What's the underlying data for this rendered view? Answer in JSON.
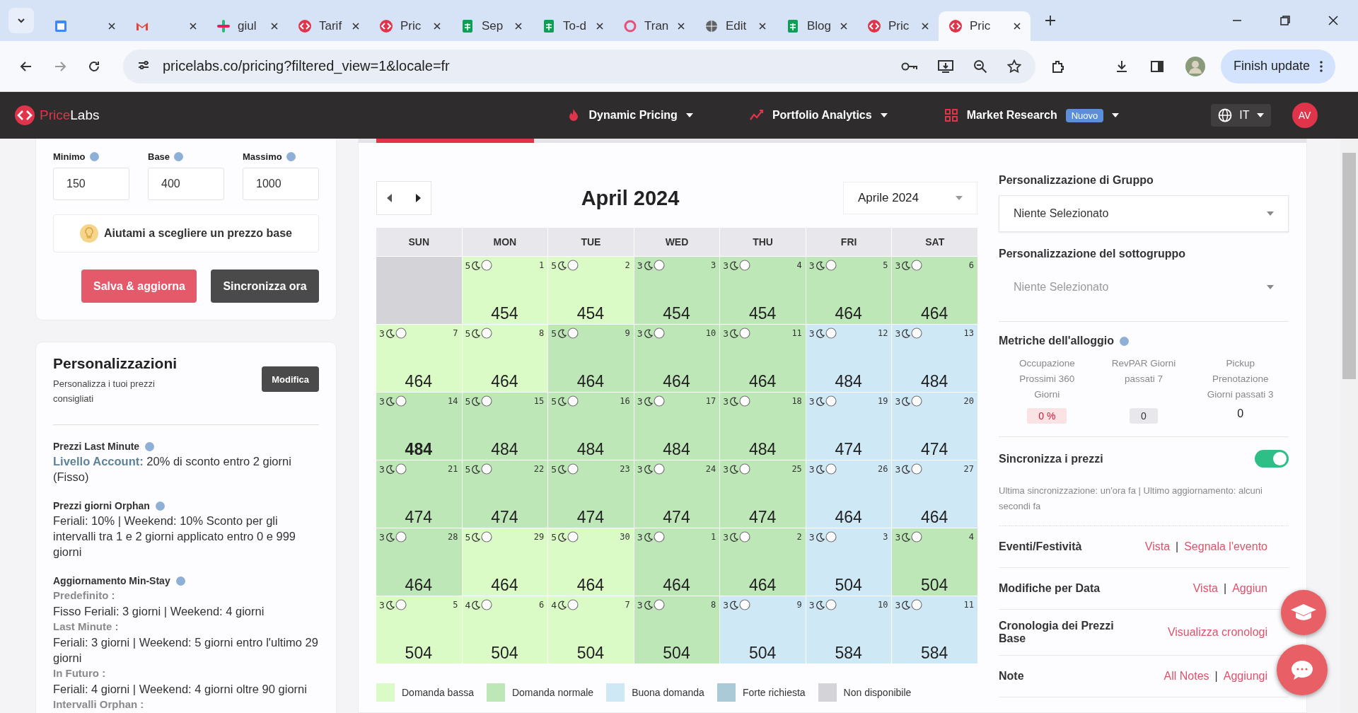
{
  "browser": {
    "tabs": [
      {
        "selected": false
      },
      {
        "selected": false
      },
      {
        "title": "giul",
        "selected": false
      },
      {
        "title": "Tarif",
        "selected": false
      },
      {
        "title": "Pric",
        "selected": false
      },
      {
        "title": "Sep",
        "selected": false
      },
      {
        "title": "To-d",
        "selected": false
      },
      {
        "title": "Tran",
        "selected": false
      },
      {
        "title": "Edit",
        "selected": false
      },
      {
        "title": "Blog",
        "selected": false
      },
      {
        "title": "Pric",
        "selected": false
      },
      {
        "title": "Pric",
        "selected": true
      }
    ],
    "url": "pricelabs.co/pricing?filtered_view=1&locale=fr",
    "update": "Finish update"
  },
  "header": {
    "logo_a": "Price",
    "logo_b": "Labs",
    "nav": [
      {
        "label": "Dynamic Pricing"
      },
      {
        "label": "Portfolio Analytics"
      },
      {
        "label": "Market Research",
        "badge": "Nuovo"
      }
    ],
    "language": "IT",
    "avatar": "AV"
  },
  "prices": {
    "fields": [
      {
        "label": "Minimo",
        "value": "150"
      },
      {
        "label": "Base",
        "value": "400"
      },
      {
        "label": "Massimo",
        "value": "1000"
      }
    ],
    "help": "Aiutami a scegliere un prezzo base",
    "save": "Salva & aggiorna",
    "sync": "Sincronizza ora"
  },
  "customizations": {
    "title": "Personalizzazioni",
    "subtitle": "Personalizza i tuoi prezzi consigliati",
    "edit": "Modifica",
    "sections": [
      {
        "title": "Prezzi Last Minute",
        "lines": [
          {
            "kind": "text",
            "text": "**Livello Account:** 20% di sconto entro 2 giorni (Fisso)"
          }
        ]
      },
      {
        "title": "Prezzi giorni Orphan",
        "lines": [
          {
            "kind": "text",
            "text": "Feriali: 10% | Weekend: 10% Sconto per gli intervalli tra 1 e 2 giorni applicato entro 0 e 999 giorni"
          }
        ]
      },
      {
        "title": "Aggiornamento Min-Stay",
        "lines": [
          {
            "kind": "heading",
            "text": "Predefinito :"
          },
          {
            "kind": "text",
            "text": "Fisso Feriali: 3 giorni | Weekend: 4 giorni"
          },
          {
            "kind": "heading",
            "text": "Last Minute :"
          },
          {
            "kind": "text",
            "text": "Feriali: 3 giorni | Weekend: 5 giorni entro l'ultimo 29 giorni"
          },
          {
            "kind": "heading",
            "text": "In Futuro :"
          },
          {
            "kind": "text",
            "text": "Feriali: 4 giorni | Weekend: 4 giorni oltre 90 giorni"
          },
          {
            "kind": "heading",
            "text": "Intervalli Orphan :"
          }
        ]
      }
    ]
  },
  "calendar": {
    "title": "April 2024",
    "month_select": "Aprile 2024",
    "weekdays": [
      "SUN",
      "MON",
      "TUE",
      "WED",
      "THU",
      "FRI",
      "SAT"
    ],
    "weeks": [
      {
        "days": [
          {
            "color": "#d4d4d8"
          },
          {
            "day": "1",
            "min_stay": "5",
            "price": "454",
            "color": "#dafac6",
            "highlighted": false
          },
          {
            "day": "2",
            "min_stay": "5",
            "price": "454",
            "color": "#dafac6",
            "highlighted": false
          },
          {
            "day": "3",
            "min_stay": "3",
            "price": "454",
            "color": "#bde7b6",
            "highlighted": false
          },
          {
            "day": "4",
            "min_stay": "3",
            "price": "454",
            "color": "#bde7b6",
            "highlighted": false
          },
          {
            "day": "5",
            "min_stay": "3",
            "price": "464",
            "color": "#bde7b6",
            "highlighted": false
          },
          {
            "day": "6",
            "min_stay": "3",
            "price": "464",
            "color": "#bde7b6",
            "highlighted": false
          }
        ]
      },
      {
        "days": [
          {
            "day": "7",
            "min_stay": "3",
            "price": "464",
            "color": "#dafac6",
            "highlighted": false
          },
          {
            "day": "8",
            "min_stay": "5",
            "price": "464",
            "color": "#dafac6",
            "highlighted": false
          },
          {
            "day": "9",
            "min_stay": "5",
            "price": "464",
            "color": "#bde7b6",
            "highlighted": false
          },
          {
            "day": "10",
            "min_stay": "3",
            "price": "464",
            "color": "#bde7b6",
            "highlighted": false
          },
          {
            "day": "11",
            "min_stay": "3",
            "price": "464",
            "color": "#bde7b6",
            "highlighted": false
          },
          {
            "day": "12",
            "min_stay": "3",
            "price": "484",
            "color": "#cfe8f6",
            "highlighted": false
          },
          {
            "day": "13",
            "min_stay": "3",
            "price": "484",
            "color": "#cfe8f6",
            "highlighted": false
          }
        ]
      },
      {
        "days": [
          {
            "day": "14",
            "min_stay": "3",
            "price": "484",
            "color": "#bde7b6",
            "highlighted": true
          },
          {
            "day": "15",
            "min_stay": "5",
            "price": "484",
            "color": "#bde7b6",
            "highlighted": false
          },
          {
            "day": "16",
            "min_stay": "5",
            "price": "484",
            "color": "#bde7b6",
            "highlighted": false
          },
          {
            "day": "17",
            "min_stay": "3",
            "price": "484",
            "color": "#bde7b6",
            "highlighted": false
          },
          {
            "day": "18",
            "min_stay": "3",
            "price": "484",
            "color": "#bde7b6",
            "highlighted": false
          },
          {
            "day": "19",
            "min_stay": "3",
            "price": "474",
            "color": "#cfe8f6",
            "highlighted": false
          },
          {
            "day": "20",
            "min_stay": "3",
            "price": "474",
            "color": "#cfe8f6",
            "highlighted": false
          }
        ]
      },
      {
        "days": [
          {
            "day": "21",
            "min_stay": "3",
            "price": "474",
            "color": "#bde7b6",
            "highlighted": false
          },
          {
            "day": "22",
            "min_stay": "5",
            "price": "474",
            "color": "#bde7b6",
            "highlighted": false
          },
          {
            "day": "23",
            "min_stay": "5",
            "price": "474",
            "color": "#bde7b6",
            "highlighted": false
          },
          {
            "day": "24",
            "min_stay": "3",
            "price": "474",
            "color": "#bde7b6",
            "highlighted": false
          },
          {
            "day": "25",
            "min_stay": "3",
            "price": "474",
            "color": "#bde7b6",
            "highlighted": false
          },
          {
            "day": "26",
            "min_stay": "3",
            "price": "464",
            "color": "#cfe8f6",
            "highlighted": false
          },
          {
            "day": "27",
            "min_stay": "3",
            "price": "464",
            "color": "#cfe8f6",
            "highlighted": false
          }
        ]
      },
      {
        "days": [
          {
            "day": "28",
            "min_stay": "3",
            "price": "464",
            "color": "#bde7b6",
            "highlighted": false
          },
          {
            "day": "29",
            "min_stay": "5",
            "price": "464",
            "color": "#dafac6",
            "highlighted": false
          },
          {
            "day": "30",
            "min_stay": "5",
            "price": "464",
            "color": "#dafac6",
            "highlighted": false
          },
          {
            "day": "1",
            "min_stay": "3",
            "price": "464",
            "color": "#bde7b6",
            "highlighted": false
          },
          {
            "day": "2",
            "min_stay": "3",
            "price": "464",
            "color": "#bde7b6",
            "highlighted": false
          },
          {
            "day": "3",
            "min_stay": "3",
            "price": "504",
            "color": "#cfe8f6",
            "highlighted": false
          },
          {
            "day": "4",
            "min_stay": "3",
            "price": "504",
            "color": "#bde7b6",
            "highlighted": false
          }
        ]
      },
      {
        "days": [
          {
            "day": "5",
            "min_stay": "3",
            "price": "504",
            "color": "#dafac6",
            "highlighted": false
          },
          {
            "day": "6",
            "min_stay": "4",
            "price": "504",
            "color": "#dafac6",
            "highlighted": false
          },
          {
            "day": "7",
            "min_stay": "4",
            "price": "504",
            "color": "#dafac6",
            "highlighted": false
          },
          {
            "day": "8",
            "min_stay": "3",
            "price": "504",
            "color": "#bde7b6",
            "highlighted": false
          },
          {
            "day": "9",
            "min_stay": "3",
            "price": "504",
            "color": "#cfe8f6",
            "highlighted": false
          },
          {
            "day": "10",
            "min_stay": "3",
            "price": "584",
            "color": "#cfe8f6",
            "highlighted": false
          },
          {
            "day": "11",
            "min_stay": "3",
            "price": "584",
            "color": "#cfe8f6",
            "highlighted": false
          }
        ]
      }
    ],
    "legend": [
      {
        "label": "Domanda bassa",
        "color": "#dafac6"
      },
      {
        "label": "Domanda normale",
        "color": "#bde7b6"
      },
      {
        "label": "Buona domanda",
        "color": "#cfe8f6"
      },
      {
        "label": "Forte richiesta",
        "color": "#a9cad6"
      },
      {
        "label": "Non disponibile",
        "color": "#d4d4d8"
      }
    ]
  },
  "side": {
    "group": {
      "title": "Personalizzazione di Gruppo",
      "value": "Niente Selezionato",
      "disabled": false
    },
    "subgroup": {
      "title": "Personalizzazione del sottogruppo",
      "value": "Niente Selezionato",
      "disabled": true
    },
    "metrics_title": "Metriche dell'alloggio",
    "metrics": [
      {
        "label": "Occupazione Prossimi 360 Giorni",
        "value": "0 %",
        "kind": "alert"
      },
      {
        "label": "RevPAR Giorni passati 7",
        "value": "0",
        "kind": "neutral"
      },
      {
        "label": "Pickup Prenotazione Giorni passati 3",
        "value": "0",
        "kind": "plain"
      }
    ],
    "sync": {
      "title": "Sincronizza i prezzi",
      "on": true,
      "note": "Ultima sincronizzazione: un'ora fa | Ultimo aggiornamento: alcuni secondi fa"
    },
    "rows": [
      {
        "title": "Eventi/Festività",
        "links": [
          {
            "kind": "link",
            "text": "Vista"
          },
          {
            "kind": "sep",
            "text": "|"
          },
          {
            "kind": "link",
            "text": "Segnala l'evento"
          }
        ]
      },
      {
        "title": "Modifiche per Data",
        "links": [
          {
            "kind": "link",
            "text": "Vista"
          },
          {
            "kind": "sep",
            "text": "|"
          },
          {
            "kind": "link",
            "text": "Aggiun"
          }
        ]
      },
      {
        "title": "Cronologia dei Prezzi Base",
        "links": [
          {
            "kind": "link",
            "text": "Visualizza cronologi"
          }
        ]
      },
      {
        "title": "Note",
        "links": [
          {
            "kind": "link",
            "text": "All Notes"
          },
          {
            "kind": "sep",
            "text": "|"
          },
          {
            "kind": "link",
            "text": "Aggiungi"
          }
        ]
      }
    ]
  }
}
